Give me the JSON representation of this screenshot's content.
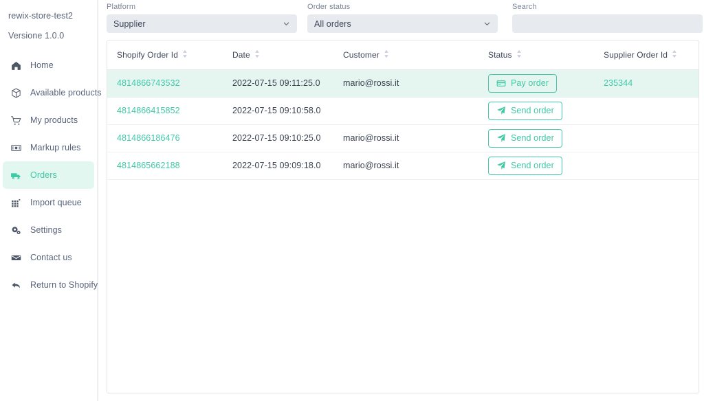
{
  "sidebar": {
    "store_name": "rewix-store-test2",
    "version": "Versione 1.0.0",
    "items": [
      {
        "label": "Home",
        "icon": "home-icon",
        "active": false
      },
      {
        "label": "Available products",
        "icon": "box-icon",
        "active": false
      },
      {
        "label": "My products",
        "icon": "shopping-cart-icon",
        "active": false
      },
      {
        "label": "Markup rules",
        "icon": "banknote-icon",
        "active": false
      },
      {
        "label": "Orders",
        "icon": "truck-icon",
        "active": true
      },
      {
        "label": "Import queue",
        "icon": "grid-icon",
        "active": false
      },
      {
        "label": "Settings",
        "icon": "gears-icon",
        "active": false
      },
      {
        "label": "Contact us",
        "icon": "envelope-icon",
        "active": false
      },
      {
        "label": "Return to Shopify",
        "icon": "arrow-back-icon",
        "active": false
      }
    ]
  },
  "filters": {
    "platform": {
      "label": "Platform",
      "value": "Supplier",
      "options": [
        "Supplier"
      ]
    },
    "order_status": {
      "label": "Order status",
      "value": "All orders",
      "options": [
        "All orders"
      ]
    },
    "search": {
      "label": "Search",
      "value": "",
      "placeholder": ""
    }
  },
  "table": {
    "columns": [
      {
        "label": "Shopify Order Id",
        "sortable": true
      },
      {
        "label": "Date",
        "sortable": true
      },
      {
        "label": "Customer",
        "sortable": true
      },
      {
        "label": "Status",
        "sortable": true
      },
      {
        "label": "Supplier Order Id",
        "sortable": true
      }
    ],
    "rows": [
      {
        "shopify_order_id": "4814866743532",
        "date": "2022-07-15 09:11:25.0",
        "customer": "mario@rossi.it",
        "action_label": "Pay order",
        "action_icon": "credit-card-icon",
        "supplier_order_id": "235344",
        "highlight": true
      },
      {
        "shopify_order_id": "4814866415852",
        "date": "2022-07-15 09:10:58.0",
        "customer": "",
        "action_label": "Send order",
        "action_icon": "paper-plane-icon",
        "supplier_order_id": "",
        "highlight": false
      },
      {
        "shopify_order_id": "4814866186476",
        "date": "2022-07-15 09:10:25.0",
        "customer": "mario@rossi.it",
        "action_label": "Send order",
        "action_icon": "paper-plane-icon",
        "supplier_order_id": "",
        "highlight": false
      },
      {
        "shopify_order_id": "4814865662188",
        "date": "2022-07-15 09:09:18.0",
        "customer": "mario@rossi.it",
        "action_label": "Send order",
        "action_icon": "paper-plane-icon",
        "supplier_order_id": "",
        "highlight": false
      }
    ]
  },
  "colors": {
    "accent": "#3fc9a5",
    "accent_border": "#46c9a8",
    "row_highlight": "#e5f6f1",
    "nav_active_bg": "#e2f7f0",
    "field_bg": "#e7eaef",
    "text": "#39404e",
    "muted": "#7a8396"
  }
}
